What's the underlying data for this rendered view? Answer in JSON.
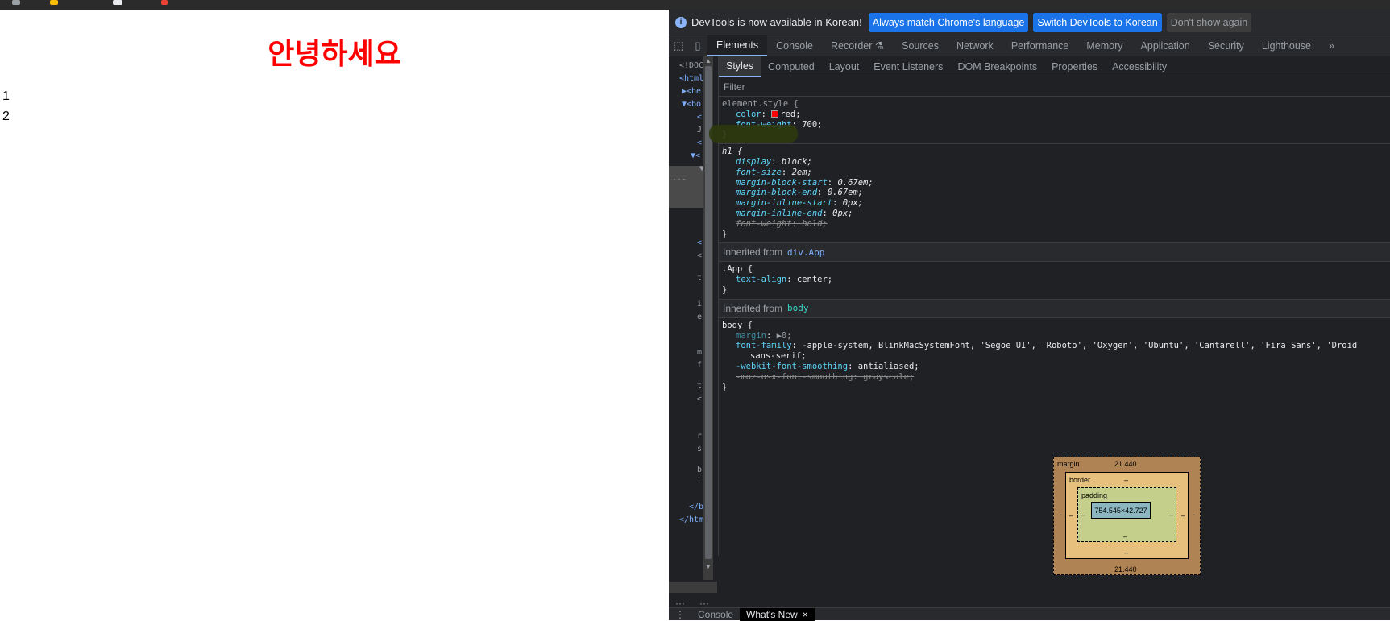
{
  "page": {
    "heading": "안녕하세요",
    "numbers": [
      "1",
      "2"
    ]
  },
  "devtools": {
    "infobar": {
      "icon": "info-icon",
      "message": "DevTools is now available in Korean!",
      "buttons": {
        "match": "Always match Chrome's language",
        "switch": "Switch DevTools to Korean",
        "dismiss": "Don't show again"
      }
    },
    "tabs": [
      "Elements",
      "Console",
      "Recorder",
      "Sources",
      "Network",
      "Performance",
      "Memory",
      "Application",
      "Security",
      "Lighthouse"
    ],
    "more_tabs": "»",
    "elements_snippets": [
      "<!DOC",
      "<html",
      "▶<he",
      "▼<bo",
      "<",
      "J",
      "<",
      "▼<",
      "▼",
      "<",
      "<",
      "t",
      "i",
      "e",
      "m",
      "f",
      "t",
      "<",
      "r",
      "s",
      "b",
      "`",
      "</b",
      "</htm"
    ],
    "subtabs": [
      "Styles",
      "Computed",
      "Layout",
      "Event Listeners",
      "DOM Breakpoints",
      "Properties",
      "Accessibility"
    ],
    "filter_placeholder": "Filter",
    "rules": {
      "element_style": {
        "selector": "element.style {",
        "color_name": "color",
        "color_value": "red;",
        "weight_name": "font-weight",
        "weight_value": "700;",
        "close": "}"
      },
      "h1": {
        "selector": "h1 {",
        "decls": [
          {
            "n": "display",
            "v": "block;"
          },
          {
            "n": "font-size",
            "v": "2em;"
          },
          {
            "n": "margin-block-start",
            "v": "0.67em;"
          },
          {
            "n": "margin-block-end",
            "v": "0.67em;"
          },
          {
            "n": "margin-inline-start",
            "v": "0px;"
          },
          {
            "n": "margin-inline-end",
            "v": "0px;"
          }
        ],
        "struck_name": "font-weight",
        "struck_value": "bold;",
        "close": "}"
      },
      "inherited_app": {
        "label": "Inherited from",
        "link": "div.App",
        "selector": ".App {",
        "prop": "text-align",
        "value": "center;",
        "close": "}"
      },
      "inherited_body": {
        "label": "Inherited from",
        "link": "body",
        "selector": "body {",
        "margin_name": "margin",
        "margin_value": "▶0;",
        "font_name": "font-family",
        "font_value": "-apple-system, BlinkMacSystemFont, 'Segoe UI', 'Roboto', 'Oxygen', 'Ubuntu', 'Cantarell', 'Fira Sans', 'Droid",
        "font_value_cont": "sans-serif;",
        "smooth_name": "-webkit-font-smoothing",
        "smooth_value": "antialiased;",
        "moz_name": "-moz-osx-font-smoothing",
        "moz_value": "grayscale;",
        "close": "}"
      }
    },
    "box_model": {
      "margin_label": "margin",
      "margin_top": "21.440",
      "margin_bottom": "21.440",
      "margin_side": "-",
      "border_label": "border",
      "border_value": "–",
      "padding_label": "padding",
      "padding_value": "–",
      "content": "754.545×42.727"
    },
    "drawer": {
      "menu_icon": "more-vert-icon",
      "tabs": [
        "Console",
        "What's New"
      ],
      "close": "×"
    }
  }
}
